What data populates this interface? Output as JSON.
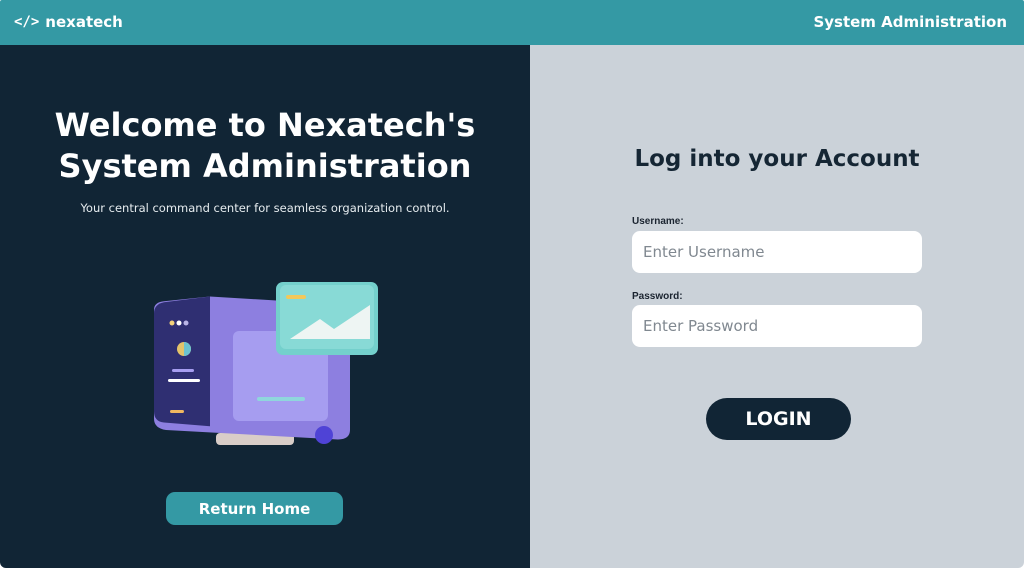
{
  "header": {
    "logo_icon": "</>",
    "logo_text": "nexatech",
    "section_title": "System Administration"
  },
  "hero": {
    "heading_line1": "Welcome to Nexatech's",
    "heading_line2": "System Administration",
    "subtitle": "Your central command center for seamless organization control.",
    "return_label": "Return Home"
  },
  "login": {
    "heading": "Log into your Account",
    "username_label": "Username:",
    "username_placeholder": "Enter Username",
    "password_label": "Password:",
    "password_placeholder": "Enter Password",
    "submit_label": "LOGIN"
  },
  "colors": {
    "header_bg": "#3499a4",
    "left_bg": "#112535",
    "right_bg": "#cbd2d9",
    "button_teal": "#3499a4",
    "button_dark": "#112535"
  }
}
